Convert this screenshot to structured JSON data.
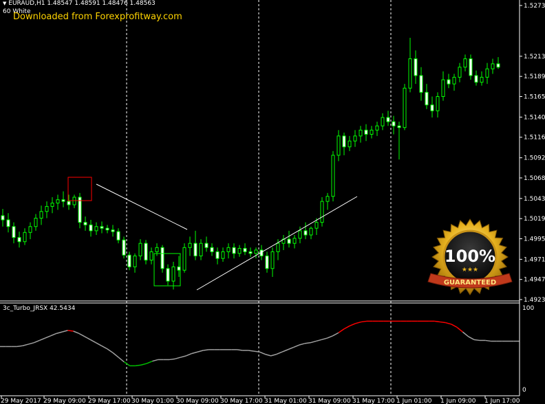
{
  "header": {
    "symbol_ohlc": "EURAUD,H1  1.48547 1.48591 1.48476 1.48563",
    "template": "60 White",
    "watermark": "Downloaded from Forexprofitway.com"
  },
  "indicator": {
    "label": "3c_Turbo_JRSX 42.5434",
    "scale_top": "100",
    "scale_bottom": "0"
  },
  "badge": {
    "big_text": "100%",
    "ribbon_text": "GUARANTEED",
    "stars": "★★★"
  },
  "colors": {
    "background": "#000000",
    "candle": "#00ff00",
    "indicator_neutral": "#a0a0a0",
    "indicator_up": "#ff0000",
    "indicator_down": "#00c000",
    "watermark": "#ffd400"
  },
  "price_axis": [
    "1.52735",
    "1.52130",
    "1.51890",
    "1.51650",
    "1.51405",
    "1.51165",
    "1.50920",
    "1.50680",
    "1.50435",
    "1.50195",
    "1.49955",
    "1.49710",
    "1.49470",
    "1.49230"
  ],
  "time_axis": [
    "29 May 2017",
    "29 May 09:00",
    "29 May 17:00",
    "30 May 01:00",
    "30 May 09:00",
    "30 May 17:00",
    "31 May 01:00",
    "31 May 09:00",
    "31 May 17:00",
    "1 Jun 01:00",
    "1 Jun 09:00",
    "1 Jun 17:00"
  ],
  "chart_data": {
    "type": "candlestick",
    "title": "EURAUD,H1",
    "candles": [
      [
        1.5023,
        1.5031,
        1.501,
        1.5018
      ],
      [
        1.5018,
        1.5026,
        1.5003,
        1.501
      ],
      [
        1.501,
        1.5015,
        1.499,
        1.4997
      ],
      [
        1.4997,
        1.5004,
        1.4985,
        1.4992
      ],
      [
        1.4992,
        1.5008,
        1.4988,
        1.5003
      ],
      [
        1.5003,
        1.5015,
        1.4995,
        1.501
      ],
      [
        1.501,
        1.5025,
        1.5005,
        1.502
      ],
      [
        1.502,
        1.5035,
        1.5012,
        1.5028
      ],
      [
        1.5028,
        1.504,
        1.502,
        1.5034
      ],
      [
        1.5034,
        1.5045,
        1.5026,
        1.5038
      ],
      [
        1.5038,
        1.5048,
        1.503,
        1.5042
      ],
      [
        1.5042,
        1.5052,
        1.5033,
        1.504
      ],
      [
        1.504,
        1.5048,
        1.503,
        1.5036
      ],
      [
        1.5036,
        1.5048,
        1.5032,
        1.5045
      ],
      [
        1.5045,
        1.505,
        1.5008,
        1.5015
      ],
      [
        1.5015,
        1.5022,
        1.5005,
        1.5012
      ],
      [
        1.5012,
        1.5018,
        1.4998,
        1.5005
      ],
      [
        1.5005,
        1.5015,
        1.5,
        1.501
      ],
      [
        1.501,
        1.5016,
        1.5002,
        1.5008
      ],
      [
        1.5008,
        1.5012,
        1.5002,
        1.5006
      ],
      [
        1.5006,
        1.5012,
        1.4998,
        1.5004
      ],
      [
        1.5004,
        1.5008,
        1.499,
        1.4994
      ],
      [
        1.4994,
        1.4998,
        1.4972,
        1.4976
      ],
      [
        1.4976,
        1.498,
        1.4958,
        1.4962
      ],
      [
        1.4962,
        1.4978,
        1.4955,
        1.4975
      ],
      [
        1.4975,
        1.4995,
        1.497,
        1.499
      ],
      [
        1.499,
        1.4994,
        1.4965,
        1.497
      ],
      [
        1.497,
        1.4985,
        1.4965,
        1.498
      ],
      [
        1.498,
        1.499,
        1.4975,
        1.4985
      ],
      [
        1.4985,
        1.4988,
        1.4955,
        1.496
      ],
      [
        1.496,
        1.4965,
        1.494,
        1.4945
      ],
      [
        1.4945,
        1.4968,
        1.4935,
        1.4962
      ],
      [
        1.4962,
        1.4975,
        1.495,
        1.4958
      ],
      [
        1.4958,
        1.499,
        1.4955,
        1.4985
      ],
      [
        1.4985,
        1.4998,
        1.4975,
        1.499
      ],
      [
        1.499,
        1.5005,
        1.497,
        1.4975
      ],
      [
        1.4975,
        1.4995,
        1.497,
        1.499
      ],
      [
        1.499,
        1.4998,
        1.498,
        1.4985
      ],
      [
        1.4985,
        1.499,
        1.4975,
        1.498
      ],
      [
        1.498,
        1.4985,
        1.4965,
        1.4972
      ],
      [
        1.4972,
        1.4985,
        1.4968,
        1.498
      ],
      [
        1.498,
        1.499,
        1.4972,
        1.4985
      ],
      [
        1.4985,
        1.499,
        1.4972,
        1.4978
      ],
      [
        1.4978,
        1.4988,
        1.4974,
        1.4984
      ],
      [
        1.4984,
        1.499,
        1.4976,
        1.498
      ],
      [
        1.498,
        1.4985,
        1.4974,
        1.4978
      ],
      [
        1.4978,
        1.4985,
        1.4972,
        1.4982
      ],
      [
        1.4982,
        1.4988,
        1.497,
        1.4975
      ],
      [
        1.4975,
        1.498,
        1.4955,
        1.496
      ],
      [
        1.496,
        1.4985,
        1.495,
        1.498
      ],
      [
        1.498,
        1.4995,
        1.497,
        1.499
      ],
      [
        1.499,
        1.5,
        1.4982,
        1.4995
      ],
      [
        1.4995,
        1.5005,
        1.4985,
        1.499
      ],
      [
        1.499,
        1.5,
        1.4984,
        1.4996
      ],
      [
        1.4996,
        1.501,
        1.499,
        1.5005
      ],
      [
        1.5005,
        1.5015,
        1.4995,
        1.5
      ],
      [
        1.5,
        1.501,
        1.4995,
        1.5008
      ],
      [
        1.5008,
        1.502,
        1.5,
        1.5015
      ],
      [
        1.5015,
        1.5045,
        1.501,
        1.504
      ],
      [
        1.504,
        1.505,
        1.503,
        1.5046
      ],
      [
        1.5046,
        1.51,
        1.504,
        1.5095
      ],
      [
        1.5095,
        1.5125,
        1.5088,
        1.5118
      ],
      [
        1.5118,
        1.5122,
        1.5095,
        1.5105
      ],
      [
        1.5105,
        1.5118,
        1.51,
        1.5112
      ],
      [
        1.5112,
        1.5125,
        1.5105,
        1.5118
      ],
      [
        1.5118,
        1.513,
        1.511,
        1.5125
      ],
      [
        1.5125,
        1.5132,
        1.5112,
        1.512
      ],
      [
        1.512,
        1.513,
        1.5115,
        1.5125
      ],
      [
        1.5125,
        1.5135,
        1.5118,
        1.513
      ],
      [
        1.513,
        1.5145,
        1.5125,
        1.514
      ],
      [
        1.514,
        1.5148,
        1.513,
        1.5135
      ],
      [
        1.5135,
        1.5142,
        1.512,
        1.513
      ],
      [
        1.513,
        1.5135,
        1.509,
        1.5128
      ],
      [
        1.5128,
        1.518,
        1.5125,
        1.5175
      ],
      [
        1.5175,
        1.5235,
        1.517,
        1.521
      ],
      [
        1.521,
        1.522,
        1.518,
        1.519
      ],
      [
        1.519,
        1.52,
        1.516,
        1.517
      ],
      [
        1.517,
        1.518,
        1.515,
        1.5155
      ],
      [
        1.5155,
        1.5165,
        1.514,
        1.5148
      ],
      [
        1.5148,
        1.517,
        1.514,
        1.5165
      ],
      [
        1.5165,
        1.5195,
        1.516,
        1.5185
      ],
      [
        1.5185,
        1.5192,
        1.5175,
        1.518
      ],
      [
        1.518,
        1.5192,
        1.5172,
        1.5188
      ],
      [
        1.5188,
        1.5205,
        1.5182,
        1.52
      ],
      [
        1.52,
        1.5215,
        1.5195,
        1.521
      ],
      [
        1.521,
        1.5215,
        1.5185,
        1.519
      ],
      [
        1.519,
        1.5196,
        1.5178,
        1.5182
      ],
      [
        1.5182,
        1.5195,
        1.5178,
        1.5188
      ],
      [
        1.5188,
        1.5205,
        1.518,
        1.5198
      ],
      [
        1.5198,
        1.521,
        1.5192,
        1.5204
      ],
      [
        1.5204,
        1.5212,
        1.5198,
        1.52
      ]
    ],
    "indicator_series": {
      "name": "3c_Turbo_JRSX",
      "ylim": [
        0,
        100
      ],
      "values": [
        55,
        55,
        55,
        55,
        56,
        58,
        60,
        63,
        66,
        69,
        72,
        74,
        76,
        75,
        72,
        68,
        64,
        60,
        56,
        52,
        47,
        41,
        35,
        30,
        30,
        31,
        33,
        36,
        38,
        38,
        38,
        39,
        41,
        43,
        46,
        48,
        50,
        51,
        51,
        51,
        51,
        51,
        51,
        50,
        50,
        49,
        48,
        45,
        43,
        45,
        48,
        51,
        54,
        57,
        59,
        60,
        62,
        64,
        66,
        69,
        73,
        78,
        82,
        85,
        87,
        88,
        88,
        88,
        88,
        88,
        88,
        88,
        88,
        88,
        88,
        88,
        88,
        88,
        87,
        86,
        84,
        80,
        74,
        68,
        64,
        63,
        63,
        62,
        62,
        62,
        62,
        62,
        62
      ],
      "state_colors": [
        "gray",
        "gray",
        "gray",
        "gray",
        "gray",
        "gray",
        "gray",
        "gray",
        "gray",
        "gray",
        "gray",
        "gray",
        "red",
        "gray",
        "gray",
        "gray",
        "gray",
        "gray",
        "gray",
        "gray",
        "gray",
        "gray",
        "green",
        "green",
        "green",
        "green",
        "green",
        "gray",
        "gray",
        "gray",
        "gray",
        "gray",
        "gray",
        "gray",
        "gray",
        "gray",
        "gray",
        "gray",
        "gray",
        "gray",
        "gray",
        "gray",
        "gray",
        "gray",
        "gray",
        "gray",
        "gray",
        "gray",
        "gray",
        "gray",
        "gray",
        "gray",
        "gray",
        "gray",
        "gray",
        "gray",
        "gray",
        "gray",
        "gray",
        "gray",
        "red",
        "red",
        "red",
        "red",
        "red",
        "red",
        "red",
        "red",
        "red",
        "red",
        "red",
        "red",
        "red",
        "red",
        "red",
        "red",
        "red",
        "red",
        "red",
        "red",
        "red",
        "red",
        "gray",
        "gray",
        "gray",
        "gray",
        "gray",
        "gray",
        "gray",
        "gray",
        "gray",
        "gray",
        "gray"
      ]
    }
  }
}
